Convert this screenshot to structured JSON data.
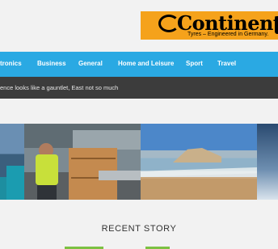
{
  "ad": {
    "brand": "Continental",
    "tagline": "Tyres – Engineered in Germany."
  },
  "nav": {
    "items": [
      "tronics",
      "Business",
      "General",
      "Home and Leisure",
      "Sport",
      "Travel"
    ]
  },
  "ticker": {
    "text": "ence looks like a gauntlet, East not so much"
  },
  "slider": {
    "images": [
      "city-waterfront-image",
      "warehouse-worker-image",
      "beach-coast-image",
      "partial-image"
    ]
  },
  "section": {
    "title": "RECENT STORY"
  },
  "colors": {
    "nav_bg": "#2aa9e3",
    "ticker_bg": "#3c3c3c",
    "ad_bg": "#f5a21b",
    "accent_green": "#7cc142"
  }
}
